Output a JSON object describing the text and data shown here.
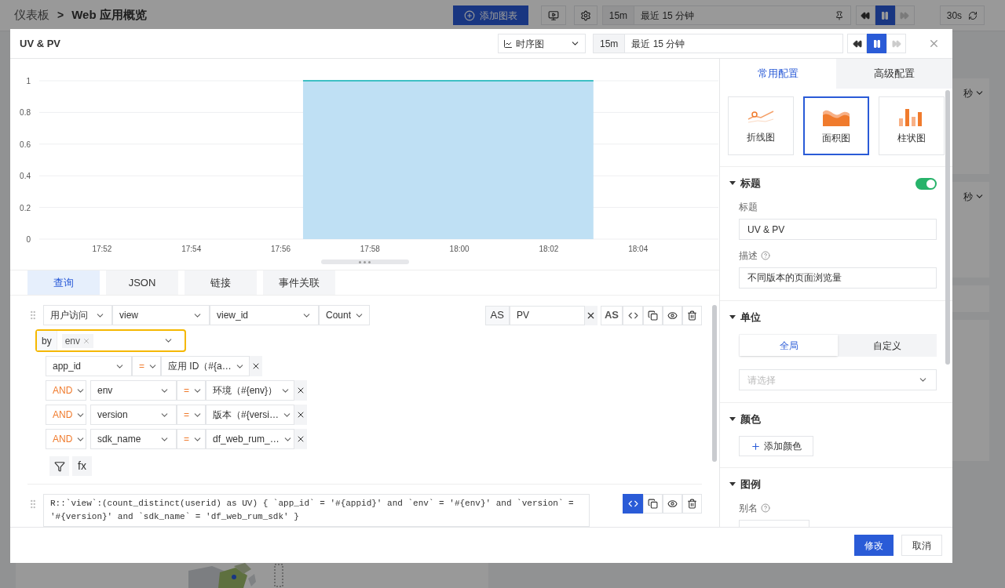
{
  "dashboard": {
    "breadcrumb": [
      "仪表板",
      "Web 应用概览"
    ],
    "separator": ">",
    "add_chart": "添加图表",
    "time_preset": "15m",
    "time_range": "最近 15 分钟",
    "paused": true,
    "refresh": "30s",
    "panel_units": [
      "秒",
      "秒"
    ]
  },
  "modal": {
    "title": "UV & PV",
    "view_select": "时序图",
    "time_preset": "15m",
    "time_range": "最近 15 分钟",
    "paused": true
  },
  "chart": {
    "chart_data": {
      "type": "area",
      "categories": [
        null,
        null,
        "17:52",
        null,
        null,
        null,
        "17:54",
        null,
        null,
        null,
        "17:56",
        null,
        null,
        null,
        "17:58",
        null,
        null,
        null,
        "18:00",
        null,
        null,
        null,
        "18:02",
        null,
        null,
        null,
        "18:04",
        null,
        null
      ],
      "values": [
        null,
        null,
        null,
        null,
        null,
        null,
        null,
        null,
        null,
        null,
        null,
        1,
        1,
        1,
        1,
        1,
        1,
        1,
        1,
        1,
        1,
        1,
        1,
        1,
        1,
        null,
        null,
        null,
        null
      ],
      "grid": true,
      "ylim": [
        0,
        1
      ],
      "yticks": [
        0,
        0.2,
        0.4,
        0.6,
        0.8,
        1
      ]
    }
  },
  "query_tabs": [
    {
      "label": "查询",
      "selected": true
    },
    {
      "label": "JSON",
      "selected": false
    },
    {
      "label": "链接",
      "selected": false
    },
    {
      "label": "事件关联",
      "selected": false
    }
  ],
  "query_1": {
    "source": "用户访问",
    "measurement": "view",
    "field": "view_id",
    "aggregate": "Count",
    "group_by": {
      "label": "by",
      "tags": [
        "env"
      ],
      "highlighted": true
    },
    "alias_label": "AS",
    "alias": "PV",
    "alias_button": "AS",
    "code_mode": false,
    "filters": [
      {
        "field": "app_id",
        "operator": "=",
        "value": "应用 ID（#{a…"
      },
      {
        "logic": "AND",
        "field": "env",
        "operator": "=",
        "value": "环境（#{env}）"
      },
      {
        "logic": "AND",
        "field": "version",
        "operator": "=",
        "value": "版本（#{versi…"
      },
      {
        "logic": "AND",
        "field": "sdk_name",
        "operator": "=",
        "value": "df_web_rum_…"
      }
    ],
    "fx_button": "fx"
  },
  "query_2": {
    "code": "R::`view`:(count_distinct(userid) as UV) { `app_id` = '#{appid}' and `env` = '#{env}' and `version` = '#{version}' and `sdk_name` = 'df_web_rum_sdk' }",
    "code_mode": true
  },
  "settings": {
    "tabs": [
      {
        "label": "常用配置",
        "selected": true
      },
      {
        "label": "高级配置",
        "selected": false
      }
    ],
    "chart_types": [
      {
        "kind": "line",
        "label": "折线图",
        "selected": false
      },
      {
        "kind": "area",
        "label": "面积图",
        "selected": true
      },
      {
        "kind": "bar",
        "label": "柱状图",
        "selected": false
      }
    ],
    "title_section": {
      "heading": "标题",
      "enabled": true,
      "title_label": "标题",
      "title_value": "UV & PV",
      "description_label": "描述",
      "description_value": "不同版本的页面浏览量"
    },
    "unit_section": {
      "heading": "单位",
      "modes": [
        {
          "label": "全局",
          "selected": true
        },
        {
          "label": "自定义",
          "selected": false
        }
      ],
      "placeholder": "请选择"
    },
    "color_section": {
      "heading": "颜色",
      "add_button": "添加颜色"
    },
    "legend_section": {
      "heading": "图例",
      "alias_label": "别名"
    }
  },
  "footer": {
    "confirm": "修改",
    "cancel": "取消"
  }
}
